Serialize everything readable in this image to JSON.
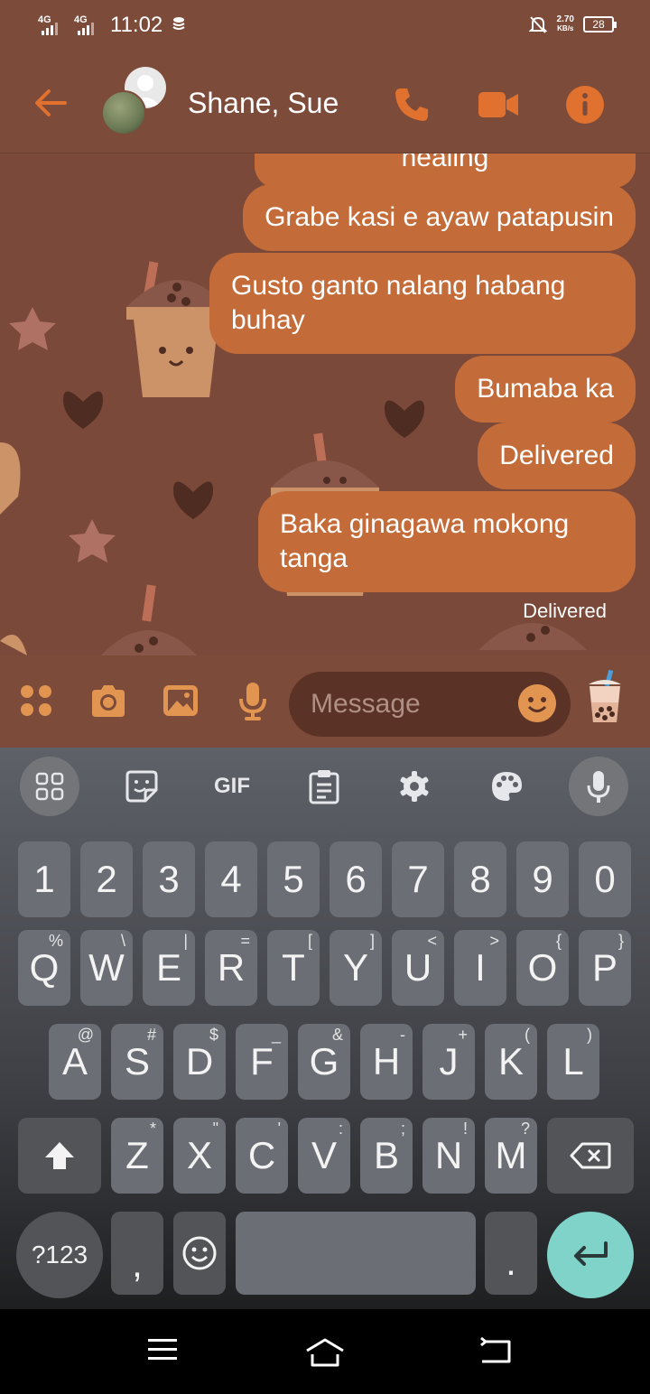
{
  "status_bar": {
    "network1": "4G",
    "network2": "4G",
    "time": "11:02",
    "speed": "2.70",
    "speed_unit": "KB/s",
    "battery": "28"
  },
  "header": {
    "title": "Shane, Sue",
    "accent_color": "#e0712f"
  },
  "messages": [
    {
      "text": "healing"
    },
    {
      "text": "Grabe kasi e ayaw patapusin"
    },
    {
      "text": "Gusto ganto nalang habang buhay"
    },
    {
      "text": "Bumaba ka"
    },
    {
      "text": "Delivered"
    },
    {
      "text": "Baka ginagawa mokong tanga"
    }
  ],
  "delivery_status": "Delivered",
  "composer": {
    "placeholder": "Message"
  },
  "keyboard": {
    "toolbar": {
      "gif": "GIF"
    },
    "number_row": [
      "1",
      "2",
      "3",
      "4",
      "5",
      "6",
      "7",
      "8",
      "9",
      "0"
    ],
    "row1": [
      {
        "k": "Q",
        "h": "%"
      },
      {
        "k": "W",
        "h": "\\"
      },
      {
        "k": "E",
        "h": "|"
      },
      {
        "k": "R",
        "h": "="
      },
      {
        "k": "T",
        "h": "["
      },
      {
        "k": "Y",
        "h": "]"
      },
      {
        "k": "U",
        "h": "<"
      },
      {
        "k": "I",
        "h": ">"
      },
      {
        "k": "O",
        "h": "{"
      },
      {
        "k": "P",
        "h": "}"
      }
    ],
    "row2": [
      {
        "k": "A",
        "h": "@"
      },
      {
        "k": "S",
        "h": "#"
      },
      {
        "k": "D",
        "h": "$"
      },
      {
        "k": "F",
        "h": "_"
      },
      {
        "k": "G",
        "h": "&"
      },
      {
        "k": "H",
        "h": "-"
      },
      {
        "k": "J",
        "h": "+"
      },
      {
        "k": "K",
        "h": "("
      },
      {
        "k": "L",
        "h": ")"
      }
    ],
    "row3": [
      {
        "k": "Z",
        "h": "*"
      },
      {
        "k": "X",
        "h": "\""
      },
      {
        "k": "C",
        "h": "'"
      },
      {
        "k": "V",
        "h": ":"
      },
      {
        "k": "B",
        "h": ";"
      },
      {
        "k": "N",
        "h": "!"
      },
      {
        "k": "M",
        "h": "?"
      }
    ],
    "symbols_label": "?123",
    "comma": ",",
    "period": "."
  }
}
